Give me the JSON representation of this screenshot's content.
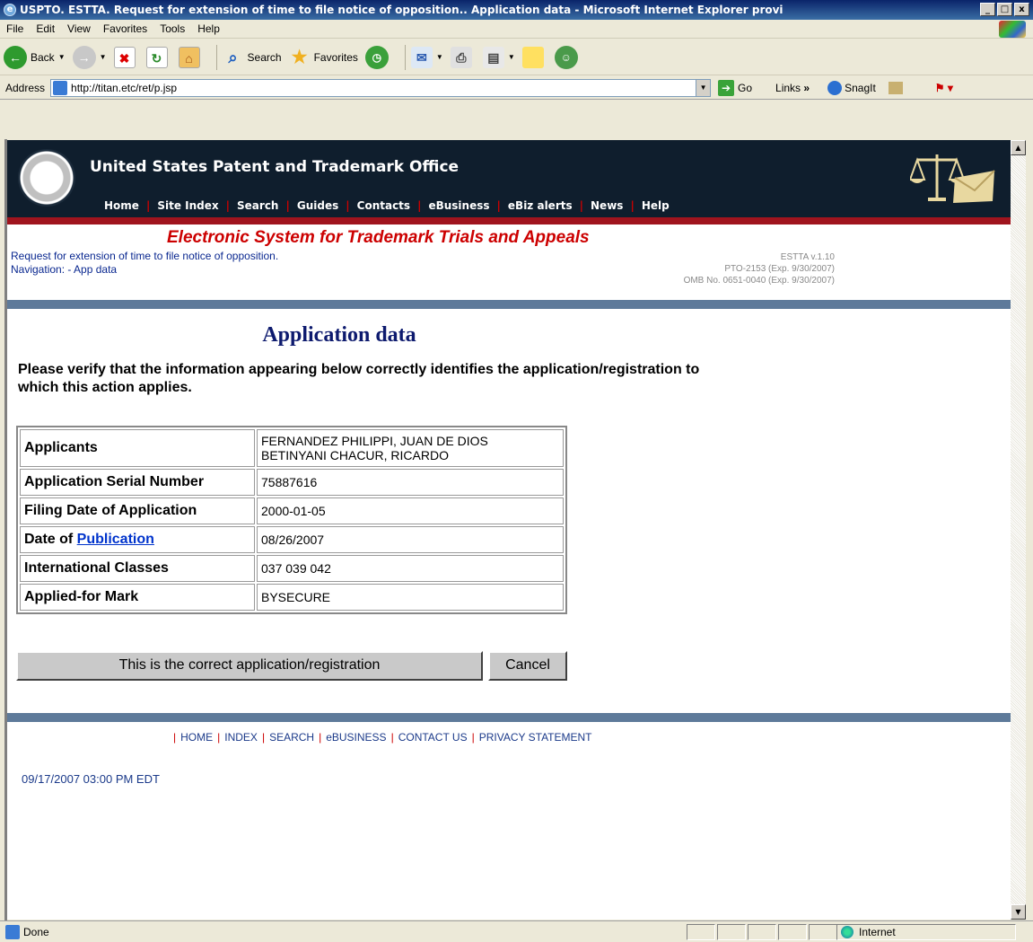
{
  "window": {
    "title": "USPTO. ESTTA. Request for extension of time to file notice of opposition.. Application data - Microsoft Internet Explorer provi",
    "controls": [
      "_",
      "□",
      "x"
    ]
  },
  "menu": [
    "File",
    "Edit",
    "View",
    "Favorites",
    "Tools",
    "Help"
  ],
  "toolbar": {
    "back": "Back",
    "search": "Search",
    "favorites": "Favorites"
  },
  "address": {
    "label": "Address",
    "url": "http://titan.etc/ret/p.jsp",
    "go": "Go",
    "links": "Links",
    "snagit": "SnagIt"
  },
  "header": {
    "office": "United States Patent and Trademark Office",
    "nav": [
      "Home",
      "Site Index",
      "Search",
      "Guides",
      "Contacts",
      "eBusiness",
      "eBiz alerts",
      "News",
      "Help"
    ]
  },
  "estta": {
    "title": "Electronic System for Trademark Trials and Appeals",
    "request": "Request for extension of time to file notice of opposition.",
    "navigation": "Navigation: - App data",
    "version": "ESTTA v.1.10",
    "pto": "PTO-2153 (Exp. 9/30/2007)",
    "omb": "OMB No. 0651-0040 (Exp. 9/30/2007)"
  },
  "page": {
    "heading": "Application data",
    "instructions": "Please verify that the information appearing below correctly identifies the application/registration to which this action applies."
  },
  "table": {
    "applicants_label": "Applicants",
    "applicants_1": "FERNANDEZ PHILIPPI, JUAN DE DIOS",
    "applicants_2": "BETINYANI CHACUR, RICARDO",
    "serial_label": "Application Serial Number",
    "serial": "75887616",
    "filing_label": "Filing Date of Application",
    "filing": "2000-01-05",
    "pub_label_prefix": "Date of ",
    "pub_link": "Publication",
    "pub": "08/26/2007",
    "classes_label": "International Classes",
    "classes": "037 039 042",
    "mark_label": "Applied-for Mark",
    "mark": "BYSECURE"
  },
  "buttons": {
    "confirm": "This is the correct application/registration",
    "cancel": "Cancel"
  },
  "footer": {
    "links": [
      "HOME",
      "INDEX",
      "SEARCH",
      "eBUSINESS",
      "CONTACT US",
      "PRIVACY STATEMENT"
    ],
    "timestamp": "09/17/2007 03:00 PM EDT"
  },
  "status": {
    "text": "Done",
    "zone": "Internet"
  }
}
